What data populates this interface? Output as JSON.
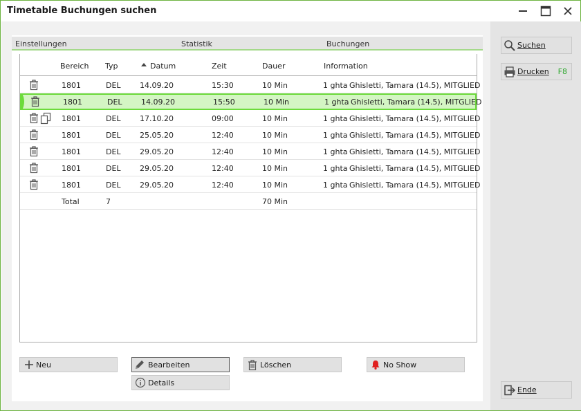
{
  "window": {
    "title": "Timetable Buchungen suchen"
  },
  "tabs": [
    {
      "label": "Einstellungen"
    },
    {
      "label": "Statistik"
    },
    {
      "label": "Buchungen"
    }
  ],
  "table": {
    "columns": [
      {
        "label": "Bereich"
      },
      {
        "label": "Typ"
      },
      {
        "label": "Datum",
        "sorted": "ascending"
      },
      {
        "label": "Zeit"
      },
      {
        "label": "Dauer"
      },
      {
        "label": "Information"
      }
    ],
    "rows": [
      {
        "bereich": "1801",
        "typ": "DEL",
        "datum": "14.09.20",
        "zeit": "15:30",
        "dauer": "10 Min",
        "anzahl": "1 ghta",
        "info": "Ghisletti, Tamara (14.5), MITGLIED",
        "icons": [
          "trash-icon"
        ],
        "selected": false
      },
      {
        "bereich": "1801",
        "typ": "DEL",
        "datum": "14.09.20",
        "zeit": "15:50",
        "dauer": "10 Min",
        "anzahl": "1 ghta",
        "info": "Ghisletti, Tamara (14.5), MITGLIED",
        "icons": [
          "trash-icon"
        ],
        "selected": true
      },
      {
        "bereich": "1801",
        "typ": "DEL",
        "datum": "17.10.20",
        "zeit": "09:00",
        "dauer": "10 Min",
        "anzahl": "1 ghta",
        "info": "Ghisletti, Tamara (14.5), MITGLIED",
        "icons": [
          "trash-icon",
          "copy-icon"
        ],
        "selected": false
      },
      {
        "bereich": "1801",
        "typ": "DEL",
        "datum": "25.05.20",
        "zeit": "12:40",
        "dauer": "10 Min",
        "anzahl": "1 ghta",
        "info": "Ghisletti, Tamara (14.5), MITGLIED",
        "icons": [
          "trash-icon"
        ],
        "selected": false
      },
      {
        "bereich": "1801",
        "typ": "DEL",
        "datum": "29.05.20",
        "zeit": "12:40",
        "dauer": "10 Min",
        "anzahl": "1 ghta",
        "info": "Ghisletti, Tamara (14.5), MITGLIED",
        "icons": [
          "trash-icon"
        ],
        "selected": false
      },
      {
        "bereich": "1801",
        "typ": "DEL",
        "datum": "29.05.20",
        "zeit": "12:40",
        "dauer": "10 Min",
        "anzahl": "1 ghta",
        "info": "Ghisletti, Tamara (14.5), MITGLIED",
        "icons": [
          "trash-icon"
        ],
        "selected": false
      },
      {
        "bereich": "1801",
        "typ": "DEL",
        "datum": "29.05.20",
        "zeit": "12:40",
        "dauer": "10 Min",
        "anzahl": "1 ghta",
        "info": "Ghisletti, Tamara (14.5), MITGLIED",
        "icons": [
          "trash-icon"
        ],
        "selected": false
      }
    ],
    "total": {
      "label": "Total",
      "count": "7",
      "dauer": "70 Min"
    }
  },
  "actions": {
    "neu": "Neu",
    "bearbeiten": "Bearbeiten",
    "loeschen": "Löschen",
    "no_show": "No Show",
    "details": "Details"
  },
  "sidebar": {
    "suchen": "Suchen",
    "drucken": "Drucken",
    "drucken_key": "F8",
    "ende": "Ende"
  },
  "colors": {
    "accent_green": "#6cb33f",
    "selection_fill": "#d4f5c4",
    "selection_border": "#6cdb3b",
    "shortcut_green": "#2ea82e",
    "bell_red": "#e02020"
  }
}
